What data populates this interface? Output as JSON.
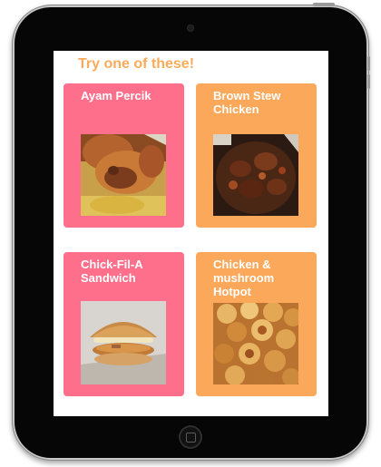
{
  "screen": {
    "title": "Try one of these!"
  },
  "recipes": [
    {
      "name": "Ayam Percik",
      "color": "#fe6f8b",
      "image_icon": "ayam-percik-photo"
    },
    {
      "name": "Brown Stew Chicken",
      "color": "#fca85a",
      "image_icon": "brown-stew-chicken-photo"
    },
    {
      "name": "Chick-Fil-A Sandwich",
      "color": "#fe6f8b",
      "image_icon": "chick-fil-a-sandwich-photo"
    },
    {
      "name": "Chicken & mushroom Hotpot",
      "color": "#fca85a",
      "image_icon": "chicken-mushroom-hotpot-photo"
    }
  ],
  "colors": {
    "title": "#f8ab5b",
    "card_pink": "#fe6f8b",
    "card_orange": "#fca85a",
    "device_bezel": "#060606"
  }
}
